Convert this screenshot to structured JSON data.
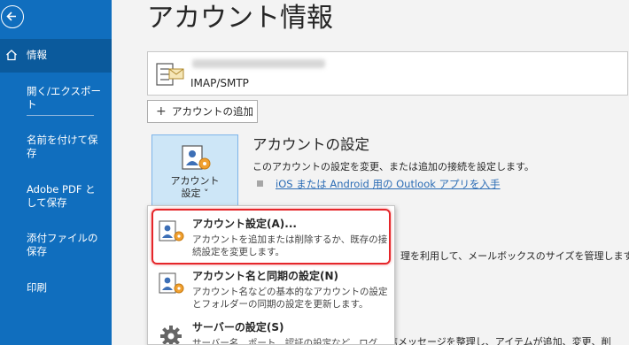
{
  "sidebar": {
    "items": [
      {
        "label": "情報",
        "icon": "home-icon"
      },
      {
        "label": "開く/エクスポート"
      },
      {
        "label": "名前を付けて保存"
      },
      {
        "label": "Adobe PDF として保存"
      },
      {
        "label": "添付ファイルの保存"
      },
      {
        "label": "印刷"
      }
    ]
  },
  "main": {
    "title": "アカウント情報",
    "account": {
      "type": "IMAP/SMTP"
    },
    "add_account_label": "アカウントの追加",
    "settings_button_label": "アカウント\n設定 ˅",
    "section": {
      "title": "アカウントの設定",
      "description": "このアカウントの設定を変更、または追加の接続を設定します。",
      "mobile_link": "iOS または Android 用の Outlook アプリを入手"
    },
    "behind_text_1": "理を利用して、メールボックスのサイズを管理します。",
    "behind_text_2": "受信メッセージを整理し、アイテムが追加、変更、削"
  },
  "dropdown": {
    "items": [
      {
        "title": "アカウント設定(A)...",
        "description": "アカウントを追加または削除するか、既存の接続設定を変更します。",
        "icon": "account-settings-icon"
      },
      {
        "title": "アカウント名と同期の設定(N)",
        "description": "アカウント名などの基本的なアカウントの設定とフォルダーの同期の設定を更新します。",
        "icon": "account-name-icon"
      },
      {
        "title": "サーバーの設定(S)",
        "description": "サーバー名、ポート、認証の設定など、ログ",
        "icon": "gear-icon"
      }
    ]
  },
  "colors": {
    "sidebar": "#106ebe",
    "sidebar_active": "#0b5a9c",
    "accent_link": "#2b6cb5",
    "highlight": "#e5262a"
  }
}
